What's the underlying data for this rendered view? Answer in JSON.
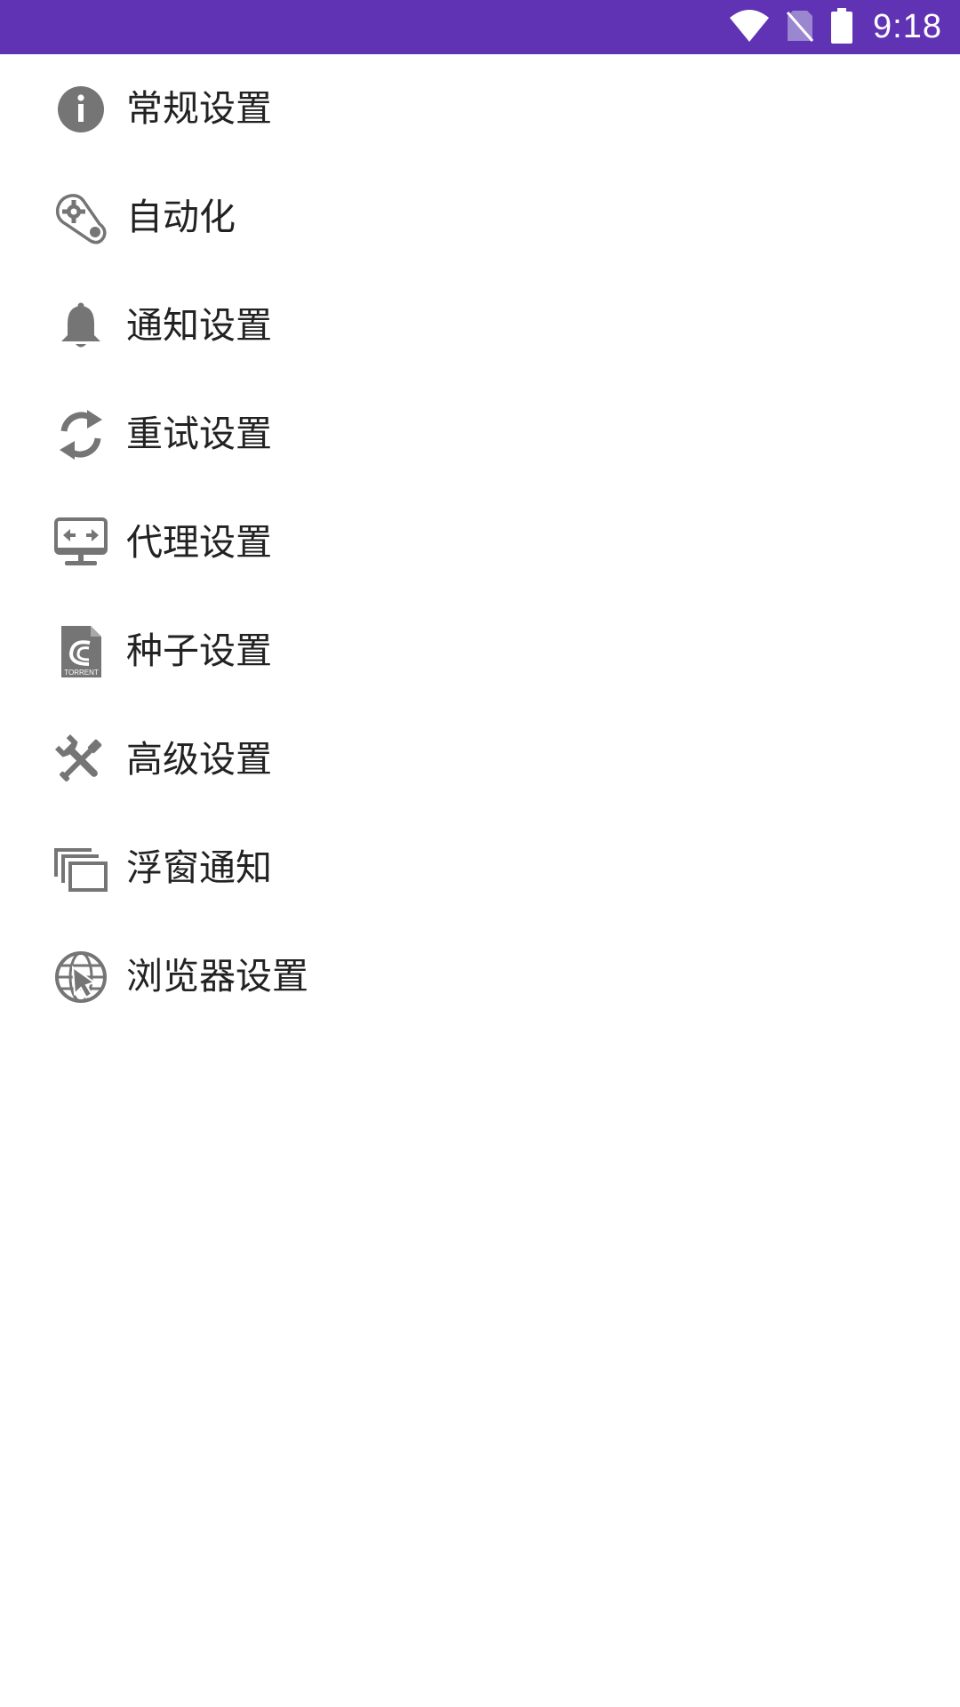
{
  "status_bar": {
    "time": "9:18",
    "background": "#6033b5",
    "icons": [
      "wifi-icon",
      "no-sim-icon",
      "battery-icon"
    ]
  },
  "icon_color": "#757575",
  "menu": {
    "items": [
      {
        "label": "常规设置",
        "icon": "info-icon"
      },
      {
        "label": "自动化",
        "icon": "automation-gear-icon"
      },
      {
        "label": "通知设置",
        "icon": "bell-icon"
      },
      {
        "label": "重试设置",
        "icon": "retry-icon"
      },
      {
        "label": "代理设置",
        "icon": "proxy-monitor-icon"
      },
      {
        "label": "种子设置",
        "icon": "torrent-file-icon"
      },
      {
        "label": "高级设置",
        "icon": "wrench-screwdriver-icon"
      },
      {
        "label": "浮窗通知",
        "icon": "floating-window-icon"
      },
      {
        "label": "浏览器设置",
        "icon": "globe-cursor-icon"
      }
    ]
  }
}
